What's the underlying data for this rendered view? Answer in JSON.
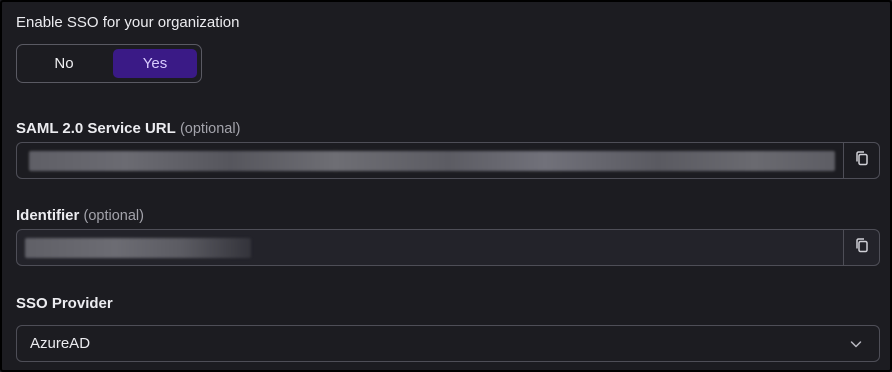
{
  "sso": {
    "enable_label": "Enable SSO for your organization",
    "toggle": {
      "no_label": "No",
      "yes_label": "Yes",
      "selected": "Yes"
    }
  },
  "saml": {
    "label": "SAML 2.0 Service URL",
    "optional": "(optional)",
    "copy_icon": "copy-icon"
  },
  "identifier": {
    "label": "Identifier",
    "optional": "(optional)",
    "copy_icon": "copy-icon"
  },
  "provider": {
    "label": "SSO Provider",
    "selected": "AzureAD",
    "chevron_icon": "chevron-down-icon"
  },
  "colors": {
    "background": "#1c1c21",
    "accent": "#3a1a86",
    "accent_text": "#d9ccff",
    "border": "#4e4e57"
  }
}
